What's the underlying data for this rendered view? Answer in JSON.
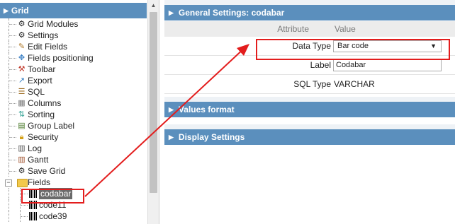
{
  "tree": {
    "title": "Grid",
    "items": [
      {
        "label": "Grid Modules",
        "icon": "gear-icon"
      },
      {
        "label": "Settings",
        "icon": "gear-icon"
      },
      {
        "label": "Edit Fields",
        "icon": "pencil-icon"
      },
      {
        "label": "Fields positioning",
        "icon": "move-icon"
      },
      {
        "label": "Toolbar",
        "icon": "tools-icon"
      },
      {
        "label": "Export",
        "icon": "export-icon"
      },
      {
        "label": "SQL",
        "icon": "database-icon"
      },
      {
        "label": "Columns",
        "icon": "columns-icon"
      },
      {
        "label": "Sorting",
        "icon": "sort-icon"
      },
      {
        "label": "Group Label",
        "icon": "group-icon"
      },
      {
        "label": "Security",
        "icon": "lock-icon"
      },
      {
        "label": "Log",
        "icon": "log-icon"
      },
      {
        "label": "Gantt",
        "icon": "gantt-icon"
      },
      {
        "label": "Save Grid",
        "icon": "gear-icon"
      },
      {
        "label": "Fields",
        "icon": "folder-icon"
      }
    ],
    "fields": [
      {
        "label": "codabar"
      },
      {
        "label": "code11"
      },
      {
        "label": "code39"
      }
    ]
  },
  "general": {
    "title": "General Settings: codabar",
    "col_attribute": "Attribute",
    "col_value": "Value",
    "rows": [
      {
        "key": "Data Type",
        "value": "Bar code"
      },
      {
        "key": "Label",
        "value": "Codabar"
      },
      {
        "key": "SQL Type",
        "value": "VARCHAR"
      }
    ]
  },
  "values_format": {
    "title": "Values format"
  },
  "display_settings": {
    "title": "Display Settings"
  },
  "colors": {
    "header": "#5b8fbd",
    "highlight": "#e31d1d"
  }
}
